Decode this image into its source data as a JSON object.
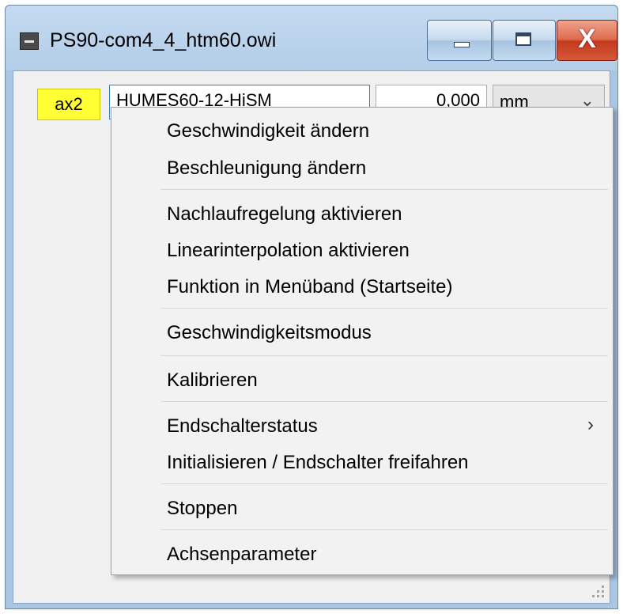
{
  "window": {
    "title": "PS90-com4_4_htm60.owi",
    "close_glyph": "X"
  },
  "axis_row": {
    "badge": "ax2",
    "name": "HUMES60-12-HiSM",
    "value": "0,000",
    "unit": "mm",
    "unit_chevron": "⌄"
  },
  "context_menu": {
    "items": [
      {
        "label": "Geschwindigkeit ändern"
      },
      {
        "label": "Beschleunigung ändern"
      },
      {
        "label": "Nachlaufregelung aktivieren"
      },
      {
        "label": "Linearinterpolation aktivieren"
      },
      {
        "label": "Funktion in Menüband (Startseite)"
      },
      {
        "label": "Geschwindigkeitsmodus"
      },
      {
        "label": "Kalibrieren"
      },
      {
        "label": "Endschalterstatus",
        "submenu_arrow": "›"
      },
      {
        "label": "Initialisieren / Endschalter freifahren"
      },
      {
        "label": "Stoppen"
      },
      {
        "label": "Achsenparameter"
      }
    ]
  },
  "colors": {
    "axis_badge": "#ffff33",
    "close_button": "#c4391d",
    "menu_background": "#f2f2f2"
  },
  "icons": [
    "app-icon",
    "minimize-icon",
    "maximize-icon",
    "close-icon",
    "chevron-down-icon",
    "submenu-arrow-icon",
    "resize-grip-icon"
  ]
}
